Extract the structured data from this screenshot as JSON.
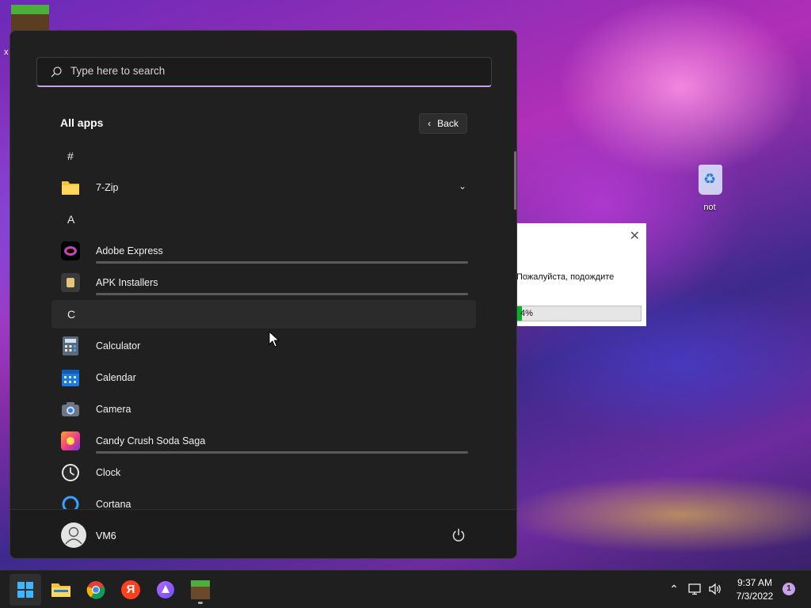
{
  "desktop": {
    "corner_label": "x",
    "recycle_bin_label": "not"
  },
  "dialog": {
    "message": "Пожалуйста, подождите",
    "progress_percent": 4,
    "progress_text": "4%"
  },
  "start_menu": {
    "search_placeholder": "Type here to search",
    "all_apps_title": "All apps",
    "back_label": "Back",
    "rows": [
      {
        "kind": "letter",
        "text": "#"
      },
      {
        "kind": "app",
        "name": "7-Zip",
        "icon": "folder-icon",
        "expandable": true
      },
      {
        "kind": "letter",
        "text": "A"
      },
      {
        "kind": "app",
        "name": "Adobe Express",
        "icon": "adobe-express-icon",
        "installing": true
      },
      {
        "kind": "app",
        "name": "APK Installers",
        "icon": "apk-installer-icon",
        "installing": true
      },
      {
        "kind": "letter",
        "text": "C",
        "hover": true
      },
      {
        "kind": "app",
        "name": "Calculator",
        "icon": "calculator-icon"
      },
      {
        "kind": "app",
        "name": "Calendar",
        "icon": "calendar-icon"
      },
      {
        "kind": "app",
        "name": "Camera",
        "icon": "camera-icon"
      },
      {
        "kind": "app",
        "name": "Candy Crush Soda Saga",
        "icon": "candy-crush-icon",
        "installing": true
      },
      {
        "kind": "app",
        "name": "Clock",
        "icon": "clock-icon"
      },
      {
        "kind": "app",
        "name": "Cortana",
        "icon": "cortana-icon"
      }
    ],
    "user_name": "VM6"
  },
  "taskbar": {
    "apps": [
      "start-icon",
      "file-explorer-icon",
      "chrome-icon",
      "yandex-browser-icon",
      "alice-icon",
      "minecraft-icon"
    ],
    "time": "9:37 AM",
    "date": "7/3/2022",
    "notification_count": "1"
  },
  "colors": {
    "start_bg": "#202020",
    "accent": "#c9a2e6",
    "progress_green": "#06b025"
  }
}
